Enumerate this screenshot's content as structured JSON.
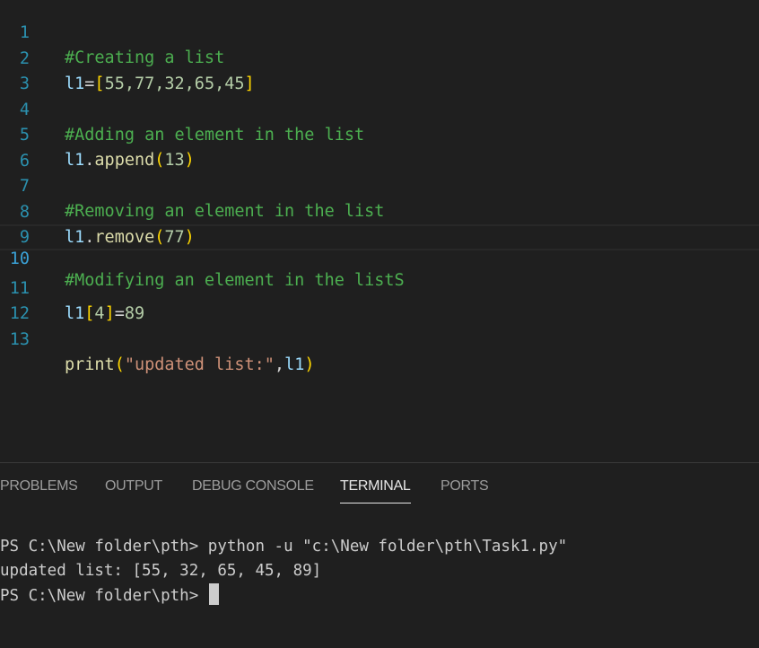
{
  "editor": {
    "current_line": 10,
    "lines": [
      {
        "num": "1",
        "comment": "#Creating a list"
      },
      {
        "num": "2",
        "var": "l1",
        "eq": "=",
        "open": "[",
        "values": "55,77,32,65,45",
        "close": "]"
      },
      {
        "num": "3"
      },
      {
        "num": "4",
        "comment": "#Adding an element in the list"
      },
      {
        "num": "5",
        "var": "l1",
        "dot": ".",
        "method": "append",
        "open": "(",
        "arg": "13",
        "close": ")"
      },
      {
        "num": "6"
      },
      {
        "num": "7",
        "comment": "#Removing an element in the list"
      },
      {
        "num": "8",
        "var": "l1",
        "dot": ".",
        "method": "remove",
        "open": "(",
        "arg": "77",
        "close": ")"
      },
      {
        "num": "9"
      },
      {
        "num": "10",
        "comment": "#Modifying an element in the listS"
      },
      {
        "num": "11",
        "var": "l1",
        "open": "[",
        "index": "4",
        "close": "]",
        "eq": "=",
        "value": "89"
      },
      {
        "num": "12"
      },
      {
        "num": "13",
        "func": "print",
        "open": "(",
        "str": "\"updated list:\"",
        "comma": ",",
        "arg": "l1",
        "close": ")"
      }
    ]
  },
  "panel": {
    "tabs": [
      {
        "label": "PROBLEMS",
        "active": false
      },
      {
        "label": "OUTPUT",
        "active": false
      },
      {
        "label": "DEBUG CONSOLE",
        "active": false
      },
      {
        "label": "TERMINAL",
        "active": true
      },
      {
        "label": "PORTS",
        "active": false
      }
    ],
    "terminal": {
      "lines": [
        "PS C:\\New folder\\pth> python -u \"c:\\New folder\\pth\\Task1.py\"",
        "updated list: [55, 32, 65, 45, 89]",
        "PS C:\\New folder\\pth> "
      ]
    }
  },
  "colors": {
    "background": "#1f1f1f",
    "line_number": "#2b91af",
    "comment": "#4caf50",
    "variable": "#9cdcfe",
    "number": "#b5cea8",
    "bracket": "#ffd700",
    "function": "#dcdcaa",
    "string": "#ce9178",
    "tab_active": "#e7e7e7",
    "tab_inactive": "#9d9d9d"
  }
}
